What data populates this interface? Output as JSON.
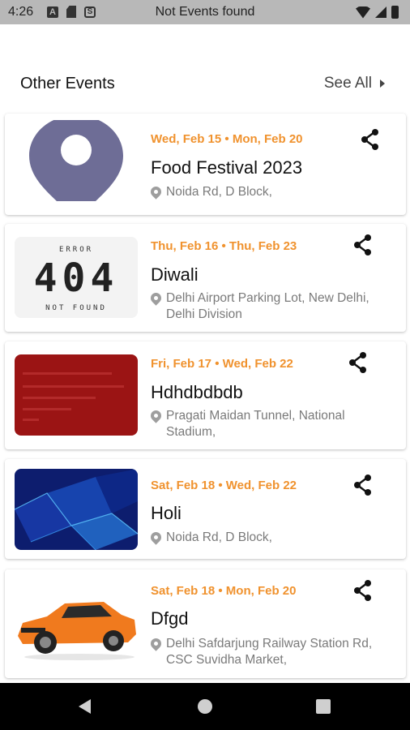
{
  "status_bar": {
    "time": "4:26",
    "title": "Not Events found",
    "icon_a": "A",
    "icon_s": "S"
  },
  "section": {
    "title": "Other Events",
    "see_all": "See All"
  },
  "events": [
    {
      "dates": "Wed, Feb 15 • Mon, Feb 20",
      "name": "Food Festival 2023",
      "location": "Noida Rd, D Block,",
      "image": "location-pin-placeholder"
    },
    {
      "dates": "Thu, Feb 16 • Thu, Feb 23",
      "name": "Diwali",
      "location": "Delhi Airport Parking Lot, New Delhi, Delhi Division",
      "image": "error-404-not-found",
      "image_text": {
        "top": "ERROR",
        "code": "404",
        "bottom": "NOT FOUND"
      }
    },
    {
      "dates": "Fri, Feb 17 • Wed, Feb 22",
      "name": "Hdhdbdbdb",
      "location": "Pragati Maidan Tunnel, National Stadium,",
      "image": "red-document"
    },
    {
      "dates": "Sat, Feb 18 • Wed, Feb 22",
      "name": "Holi",
      "location": "Noida Rd, D Block,",
      "image": "blue-abstract"
    },
    {
      "dates": "Sat, Feb 18 • Mon, Feb 20",
      "name": "Dfgd",
      "location": "Delhi Safdarjung Railway Station Rd, CSC Suvidha Market,",
      "image": "orange-sports-car"
    }
  ],
  "colors": {
    "accent": "#f0922e",
    "pin_placeholder": "#6e6d96",
    "red_image": "#9b1414",
    "blue_image": "#0d1d6e",
    "car": "#f07a1e"
  },
  "icons": {
    "share": "share-icon",
    "location": "location-pin-icon",
    "see_all_arrow": "chevron-right-icon"
  }
}
